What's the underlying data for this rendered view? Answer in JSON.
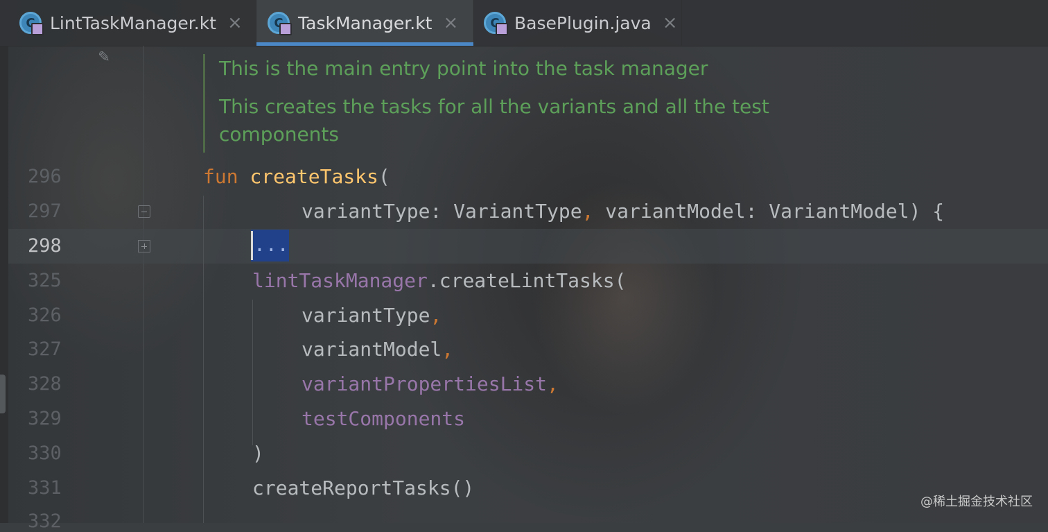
{
  "tabs": [
    {
      "label": "LintTaskManager.kt",
      "active": false
    },
    {
      "label": "TaskManager.kt",
      "active": true
    },
    {
      "label": "BasePlugin.java",
      "active": false
    }
  ],
  "tab_close_glyph": "×",
  "doc_comment": [
    "This is the main entry point into the task manager",
    "This creates the tasks for all the variants and all the test",
    "components"
  ],
  "line_numbers": [
    "296",
    "297",
    "298",
    "325",
    "326",
    "327",
    "328",
    "329",
    "330",
    "331",
    "332"
  ],
  "current_line": "298",
  "code": {
    "fun_keyword": "fun",
    "fun_name": "createTasks",
    "open_paren": "(",
    "param1": "variantType: VariantType",
    "comma": ",",
    "param2": " variantModel: VariantModel) {",
    "folded_region": "...",
    "lint_receiver": "lintTaskManager",
    "lint_call": ".createLintTasks(",
    "arg1": "variantType",
    "arg2": "variantModel",
    "arg3": "variantPropertiesList",
    "arg4": "testComponents",
    "close_paren": ")",
    "report_call": "createReportTasks()"
  },
  "icons": {
    "tab_file": "kotlin-class-icon",
    "gutter_edit": "pencil-icon",
    "fold_collapse": "fold-minus-icon",
    "fold_expand": "fold-plus-icon"
  },
  "colors": {
    "keyword": "#cc7832",
    "function": "#ffc66d",
    "property": "#9876aa",
    "comment": "#5da05a",
    "tab_accent": "#4a88c7",
    "fold_highlight": "#21418a"
  },
  "watermark": "@稀土掘金技术社区"
}
